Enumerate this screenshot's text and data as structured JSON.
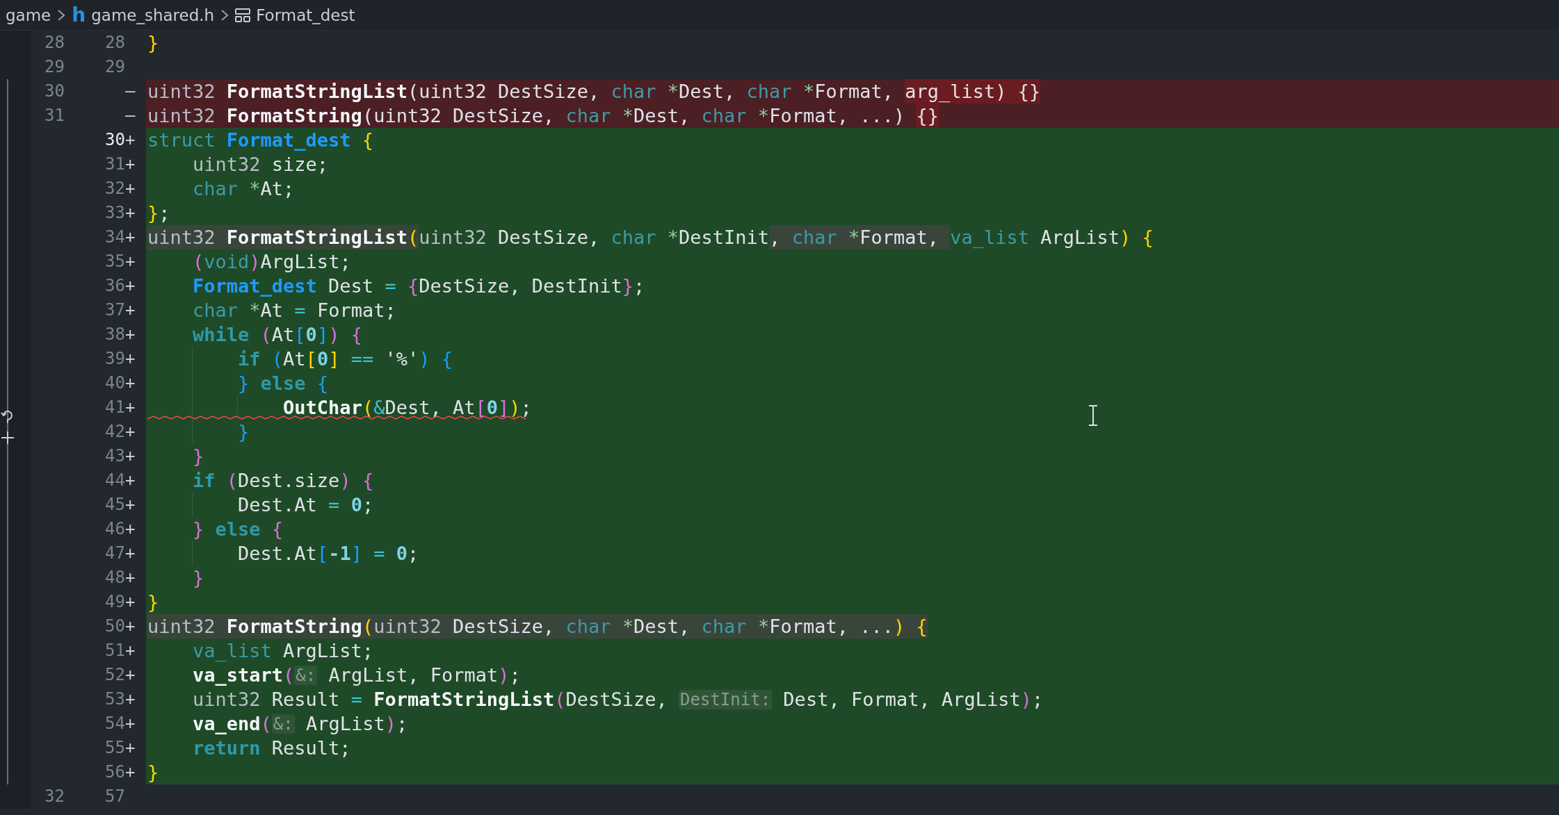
{
  "breadcrumb": [
    {
      "label": "game"
    },
    {
      "label": "game_shared.h",
      "icon_text": "h"
    },
    {
      "label": "Format_dest"
    }
  ],
  "lines": [
    {
      "old": "28",
      "new": "28",
      "kind": "context",
      "groups": [
        {
          "changed": false,
          "tokens": [
            {
              "text": "}",
              "kind": "b1"
            }
          ]
        }
      ]
    },
    {
      "old": "29",
      "new": "29",
      "kind": "context"
    },
    {
      "old": "30",
      "sign": "—",
      "kind": "removed",
      "groups": [
        {
          "changed": false,
          "tokens": [
            {
              "text": "uint32 ",
              "kind": "type"
            },
            {
              "text": "FormatStringList",
              "kind": "fn"
            },
            {
              "text": "(uint32 DestSize, ",
              "kind": "plain"
            },
            {
              "text": "char ",
              "kind": "prim"
            },
            {
              "text": "*",
              "kind": "ptr"
            },
            {
              "text": "Dest, ",
              "kind": "plain"
            },
            {
              "text": "char ",
              "kind": "prim"
            },
            {
              "text": "*",
              "kind": "ptr"
            },
            {
              "text": "Format, ",
              "kind": "plain"
            }
          ]
        },
        {
          "changed": true,
          "tokens": [
            {
              "text": "arg_list) {}",
              "kind": "plain"
            }
          ]
        }
      ]
    },
    {
      "old": "31",
      "sign": "—",
      "kind": "removed",
      "groups": [
        {
          "changed": false,
          "tokens": [
            {
              "text": "uint32 ",
              "kind": "type"
            },
            {
              "text": "FormatString",
              "kind": "fn"
            },
            {
              "text": "(uint32 DestSize, ",
              "kind": "plain"
            },
            {
              "text": "char ",
              "kind": "prim"
            },
            {
              "text": "*",
              "kind": "ptr"
            },
            {
              "text": "Dest, ",
              "kind": "plain"
            },
            {
              "text": "char ",
              "kind": "prim"
            },
            {
              "text": "*",
              "kind": "ptr"
            },
            {
              "text": "Format, ...) ",
              "kind": "plain"
            }
          ]
        },
        {
          "changed": true,
          "tokens": [
            {
              "text": "{}",
              "kind": "plain"
            }
          ]
        }
      ]
    },
    {
      "new": "30",
      "sign": "+",
      "kind": "added",
      "current": true,
      "groups": [
        {
          "changed": false,
          "tokens": [
            {
              "text": "struct ",
              "kind": "prim"
            },
            {
              "text": "Format_dest",
              "kind": "struct"
            },
            {
              "text": " {",
              "kind": "b1"
            }
          ]
        }
      ]
    },
    {
      "new": "31",
      "sign": "+",
      "kind": "added",
      "groups": [
        {
          "changed": false,
          "tokens": [
            {
              "text": "    uint32",
              "kind": "type"
            },
            {
              "text": " size;",
              "kind": "plain"
            }
          ]
        }
      ]
    },
    {
      "new": "32",
      "sign": "+",
      "kind": "added",
      "groups": [
        {
          "changed": false,
          "tokens": [
            {
              "text": "    char ",
              "kind": "prim"
            },
            {
              "text": "*",
              "kind": "ptr"
            },
            {
              "text": "At;",
              "kind": "plain"
            }
          ]
        }
      ]
    },
    {
      "new": "33",
      "sign": "+",
      "kind": "added",
      "groups": [
        {
          "changed": false,
          "tokens": [
            {
              "text": "}",
              "kind": "b1"
            },
            {
              "text": ";",
              "kind": "plain"
            }
          ]
        }
      ]
    },
    {
      "new": "34",
      "sign": "+",
      "kind": "added",
      "groups": [
        {
          "changed": true,
          "tokens": [
            {
              "text": "uint32 ",
              "kind": "type"
            },
            {
              "text": "FormatStringList",
              "kind": "fn"
            },
            {
              "text": "(",
              "kind": "b1"
            }
          ]
        },
        {
          "changed": false,
          "tokens": [
            {
              "text": "uint32",
              "kind": "type"
            },
            {
              "text": " DestSize, ",
              "kind": "plain"
            },
            {
              "text": "char ",
              "kind": "prim"
            },
            {
              "text": "*",
              "kind": "ptr"
            },
            {
              "text": "DestInit",
              "kind": "plain"
            }
          ]
        },
        {
          "changed": true,
          "tokens": [
            {
              "text": ", ",
              "kind": "plain"
            },
            {
              "text": "char ",
              "kind": "prim"
            },
            {
              "text": "*",
              "kind": "ptr"
            },
            {
              "text": "Format, ",
              "kind": "plain"
            }
          ]
        },
        {
          "changed": false,
          "tokens": [
            {
              "text": "va_list",
              "kind": "prim"
            },
            {
              "text": " ArgList",
              "kind": "plain"
            },
            {
              "text": ")",
              "kind": "b1"
            },
            {
              "text": " {",
              "kind": "b1"
            }
          ]
        }
      ]
    },
    {
      "new": "35",
      "sign": "+",
      "kind": "added",
      "groups": [
        {
          "changed": false,
          "tokens": [
            {
              "text": "    (",
              "kind": "b2"
            },
            {
              "text": "void",
              "kind": "prim"
            },
            {
              "text": ")",
              "kind": "b2"
            },
            {
              "text": "ArgList;",
              "kind": "plain"
            }
          ]
        }
      ]
    },
    {
      "new": "36",
      "sign": "+",
      "kind": "added",
      "groups": [
        {
          "changed": false,
          "tokens": [
            {
              "text": "    Format_dest",
              "kind": "struct"
            },
            {
              "text": " Dest ",
              "kind": "plain"
            },
            {
              "text": "= ",
              "kind": "op"
            },
            {
              "text": "{",
              "kind": "b2"
            },
            {
              "text": "DestSize, DestInit",
              "kind": "plain"
            },
            {
              "text": "}",
              "kind": "b2"
            },
            {
              "text": ";",
              "kind": "plain"
            }
          ]
        }
      ]
    },
    {
      "new": "37",
      "sign": "+",
      "kind": "added",
      "groups": [
        {
          "changed": false,
          "tokens": [
            {
              "text": "    char ",
              "kind": "prim"
            },
            {
              "text": "*",
              "kind": "ptr"
            },
            {
              "text": "At ",
              "kind": "plain"
            },
            {
              "text": "=",
              "kind": "op"
            },
            {
              "text": " Format;",
              "kind": "plain"
            }
          ]
        }
      ]
    },
    {
      "new": "38",
      "sign": "+",
      "kind": "added",
      "groups": [
        {
          "changed": false,
          "tokens": [
            {
              "text": "    while",
              "kind": "kw"
            },
            {
              "text": " (",
              "kind": "b2"
            },
            {
              "text": "At",
              "kind": "plain"
            },
            {
              "text": "[",
              "kind": "b3"
            },
            {
              "text": "0",
              "kind": "num"
            },
            {
              "text": "]",
              "kind": "b3"
            },
            {
              "text": ")",
              "kind": "b2"
            },
            {
              "text": " {",
              "kind": "b2"
            }
          ]
        }
      ]
    },
    {
      "new": "39",
      "sign": "+",
      "kind": "added",
      "groups": [
        {
          "changed": false,
          "tokens": [
            {
              "text": "        if",
              "kind": "kw"
            },
            {
              "text": " (",
              "kind": "b3"
            },
            {
              "text": "At",
              "kind": "plain"
            },
            {
              "text": "[",
              "kind": "b1"
            },
            {
              "text": "0",
              "kind": "num"
            },
            {
              "text": "]",
              "kind": "b1"
            },
            {
              "text": " ==",
              "kind": "op"
            },
            {
              "text": " '%'",
              "kind": "plain"
            },
            {
              "text": ")",
              "kind": "b3"
            },
            {
              "text": " {",
              "kind": "b3"
            }
          ]
        }
      ]
    },
    {
      "new": "40",
      "sign": "+",
      "kind": "added",
      "groups": [
        {
          "changed": false,
          "tokens": [
            {
              "text": "        }",
              "kind": "b3"
            },
            {
              "text": " else",
              "kind": "kw"
            },
            {
              "text": " {",
              "kind": "b3"
            }
          ]
        }
      ]
    },
    {
      "new": "41",
      "sign": "+",
      "kind": "added",
      "error": true,
      "gutter_actions": true,
      "groups": [
        {
          "changed": false,
          "tokens": [
            {
              "text": "            OutChar",
              "kind": "fn"
            },
            {
              "text": "(",
              "kind": "b1"
            },
            {
              "text": "&",
              "kind": "op"
            },
            {
              "text": "Dest, At",
              "kind": "plain"
            },
            {
              "text": "[",
              "kind": "b2"
            },
            {
              "text": "0",
              "kind": "num"
            },
            {
              "text": "]",
              "kind": "b2"
            },
            {
              "text": ")",
              "kind": "b1"
            },
            {
              "text": ";",
              "kind": "plain"
            }
          ]
        }
      ]
    },
    {
      "new": "42",
      "sign": "+",
      "kind": "added",
      "groups": [
        {
          "changed": false,
          "tokens": [
            {
              "text": "        }",
              "kind": "b3"
            }
          ]
        }
      ]
    },
    {
      "new": "43",
      "sign": "+",
      "kind": "added",
      "groups": [
        {
          "changed": false,
          "tokens": [
            {
              "text": "    }",
              "kind": "b2"
            }
          ]
        }
      ]
    },
    {
      "new": "44",
      "sign": "+",
      "kind": "added",
      "groups": [
        {
          "changed": false,
          "tokens": [
            {
              "text": "    if",
              "kind": "kw"
            },
            {
              "text": " (",
              "kind": "b2"
            },
            {
              "text": "Dest.size",
              "kind": "plain"
            },
            {
              "text": ")",
              "kind": "b2"
            },
            {
              "text": " {",
              "kind": "b2"
            }
          ]
        }
      ]
    },
    {
      "new": "45",
      "sign": "+",
      "kind": "added",
      "groups": [
        {
          "changed": false,
          "tokens": [
            {
              "text": "        Dest.At ",
              "kind": "plain"
            },
            {
              "text": "= ",
              "kind": "op"
            },
            {
              "text": "0",
              "kind": "num"
            },
            {
              "text": ";",
              "kind": "plain"
            }
          ]
        }
      ]
    },
    {
      "new": "46",
      "sign": "+",
      "kind": "added",
      "groups": [
        {
          "changed": false,
          "tokens": [
            {
              "text": "    }",
              "kind": "b2"
            },
            {
              "text": " else",
              "kind": "kw"
            },
            {
              "text": " {",
              "kind": "b2"
            }
          ]
        }
      ]
    },
    {
      "new": "47",
      "sign": "+",
      "kind": "added",
      "groups": [
        {
          "changed": false,
          "tokens": [
            {
              "text": "        Dest.At",
              "kind": "plain"
            },
            {
              "text": "[",
              "kind": "b3"
            },
            {
              "text": "-1",
              "kind": "num"
            },
            {
              "text": "]",
              "kind": "b3"
            },
            {
              "text": " = ",
              "kind": "op"
            },
            {
              "text": "0",
              "kind": "num"
            },
            {
              "text": ";",
              "kind": "plain"
            }
          ]
        }
      ]
    },
    {
      "new": "48",
      "sign": "+",
      "kind": "added",
      "groups": [
        {
          "changed": false,
          "tokens": [
            {
              "text": "    }",
              "kind": "b2"
            }
          ]
        }
      ]
    },
    {
      "new": "49",
      "sign": "+",
      "kind": "added",
      "groups": [
        {
          "changed": false,
          "tokens": [
            {
              "text": "}",
              "kind": "b1"
            }
          ]
        }
      ]
    },
    {
      "new": "50",
      "sign": "+",
      "kind": "added",
      "groups": [
        {
          "changed": true,
          "tokens": [
            {
              "text": "uint32 ",
              "kind": "type"
            },
            {
              "text": "FormatString",
              "kind": "fn"
            },
            {
              "text": "(",
              "kind": "b1"
            },
            {
              "text": "uint32",
              "kind": "type"
            },
            {
              "text": " DestSize, ",
              "kind": "plain"
            },
            {
              "text": "char ",
              "kind": "prim"
            },
            {
              "text": "*",
              "kind": "ptr"
            },
            {
              "text": "Dest, ",
              "kind": "plain"
            },
            {
              "text": "char ",
              "kind": "prim"
            },
            {
              "text": "*",
              "kind": "ptr"
            },
            {
              "text": "Format, ...",
              "kind": "plain"
            },
            {
              "text": ")",
              "kind": "b1"
            },
            {
              "text": " {",
              "kind": "b1"
            }
          ]
        }
      ]
    },
    {
      "new": "51",
      "sign": "+",
      "kind": "added",
      "groups": [
        {
          "changed": false,
          "tokens": [
            {
              "text": "    va_list",
              "kind": "prim"
            },
            {
              "text": " ArgList;",
              "kind": "plain"
            }
          ]
        }
      ]
    },
    {
      "new": "52",
      "sign": "+",
      "kind": "added",
      "groups": [
        {
          "changed": false,
          "tokens": [
            {
              "text": "    va_start",
              "kind": "fn"
            },
            {
              "text": "(",
              "kind": "b2"
            },
            {
              "text": "&:",
              "kind": "hint"
            },
            {
              "text": " ArgList, Format",
              "kind": "plain"
            },
            {
              "text": ")",
              "kind": "b2"
            },
            {
              "text": ";",
              "kind": "plain"
            }
          ]
        }
      ]
    },
    {
      "new": "53",
      "sign": "+",
      "kind": "added",
      "groups": [
        {
          "changed": false,
          "tokens": [
            {
              "text": "    uint32",
              "kind": "type"
            },
            {
              "text": " Result ",
              "kind": "plain"
            },
            {
              "text": "= ",
              "kind": "op"
            },
            {
              "text": "FormatStringList",
              "kind": "fn"
            },
            {
              "text": "(",
              "kind": "b2"
            },
            {
              "text": "DestSize, ",
              "kind": "plain"
            },
            {
              "text": "DestInit:",
              "kind": "hint"
            },
            {
              "text": " Dest, Format, ArgList",
              "kind": "plain"
            },
            {
              "text": ")",
              "kind": "b2"
            },
            {
              "text": ";",
              "kind": "plain"
            }
          ]
        }
      ]
    },
    {
      "new": "54",
      "sign": "+",
      "kind": "added",
      "groups": [
        {
          "changed": false,
          "tokens": [
            {
              "text": "    va_end",
              "kind": "fn"
            },
            {
              "text": "(",
              "kind": "b2"
            },
            {
              "text": "&:",
              "kind": "hint"
            },
            {
              "text": " ArgList",
              "kind": "plain"
            },
            {
              "text": ")",
              "kind": "b2"
            },
            {
              "text": ";",
              "kind": "plain"
            }
          ]
        }
      ]
    },
    {
      "new": "55",
      "sign": "+",
      "kind": "added",
      "groups": [
        {
          "changed": false,
          "tokens": [
            {
              "text": "    return",
              "kind": "kw"
            },
            {
              "text": " Result;",
              "kind": "plain"
            }
          ]
        }
      ]
    },
    {
      "new": "56",
      "sign": "+",
      "kind": "added",
      "groups": [
        {
          "changed": false,
          "tokens": [
            {
              "text": "}",
              "kind": "b1"
            }
          ]
        }
      ]
    },
    {
      "old": "32",
      "new": "57",
      "kind": "context"
    }
  ]
}
